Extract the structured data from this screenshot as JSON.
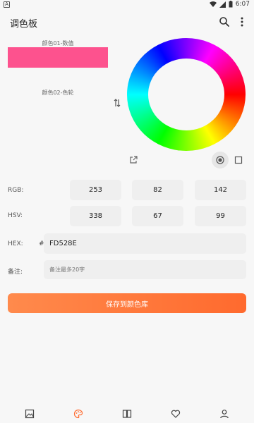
{
  "status": {
    "time": "6:07",
    "left_badge": "A"
  },
  "appbar": {
    "title": "调色板"
  },
  "panel": {
    "color01_label": "颜色01-数值",
    "color02_label": "颜色02-色轮"
  },
  "colors": {
    "swatch": "#FD528E",
    "accent": "#ff6a2e"
  },
  "rgb": {
    "label": "RGB:",
    "values": [
      "253",
      "82",
      "142"
    ]
  },
  "hsv": {
    "label": "HSV:",
    "values": [
      "338",
      "67",
      "99"
    ]
  },
  "hex": {
    "label": "HEX:",
    "hash": "#",
    "value": "FD528E"
  },
  "note": {
    "label": "备注:",
    "placeholder": "备注最多20字"
  },
  "save_button": "保存到颜色库",
  "icons": [
    "search-icon",
    "more-vertical-icon",
    "swap-icon",
    "open-external-icon",
    "radio-circle-icon",
    "square-icon",
    "gallery-icon",
    "palette-icon",
    "library-icon",
    "heart-icon",
    "user-icon"
  ]
}
